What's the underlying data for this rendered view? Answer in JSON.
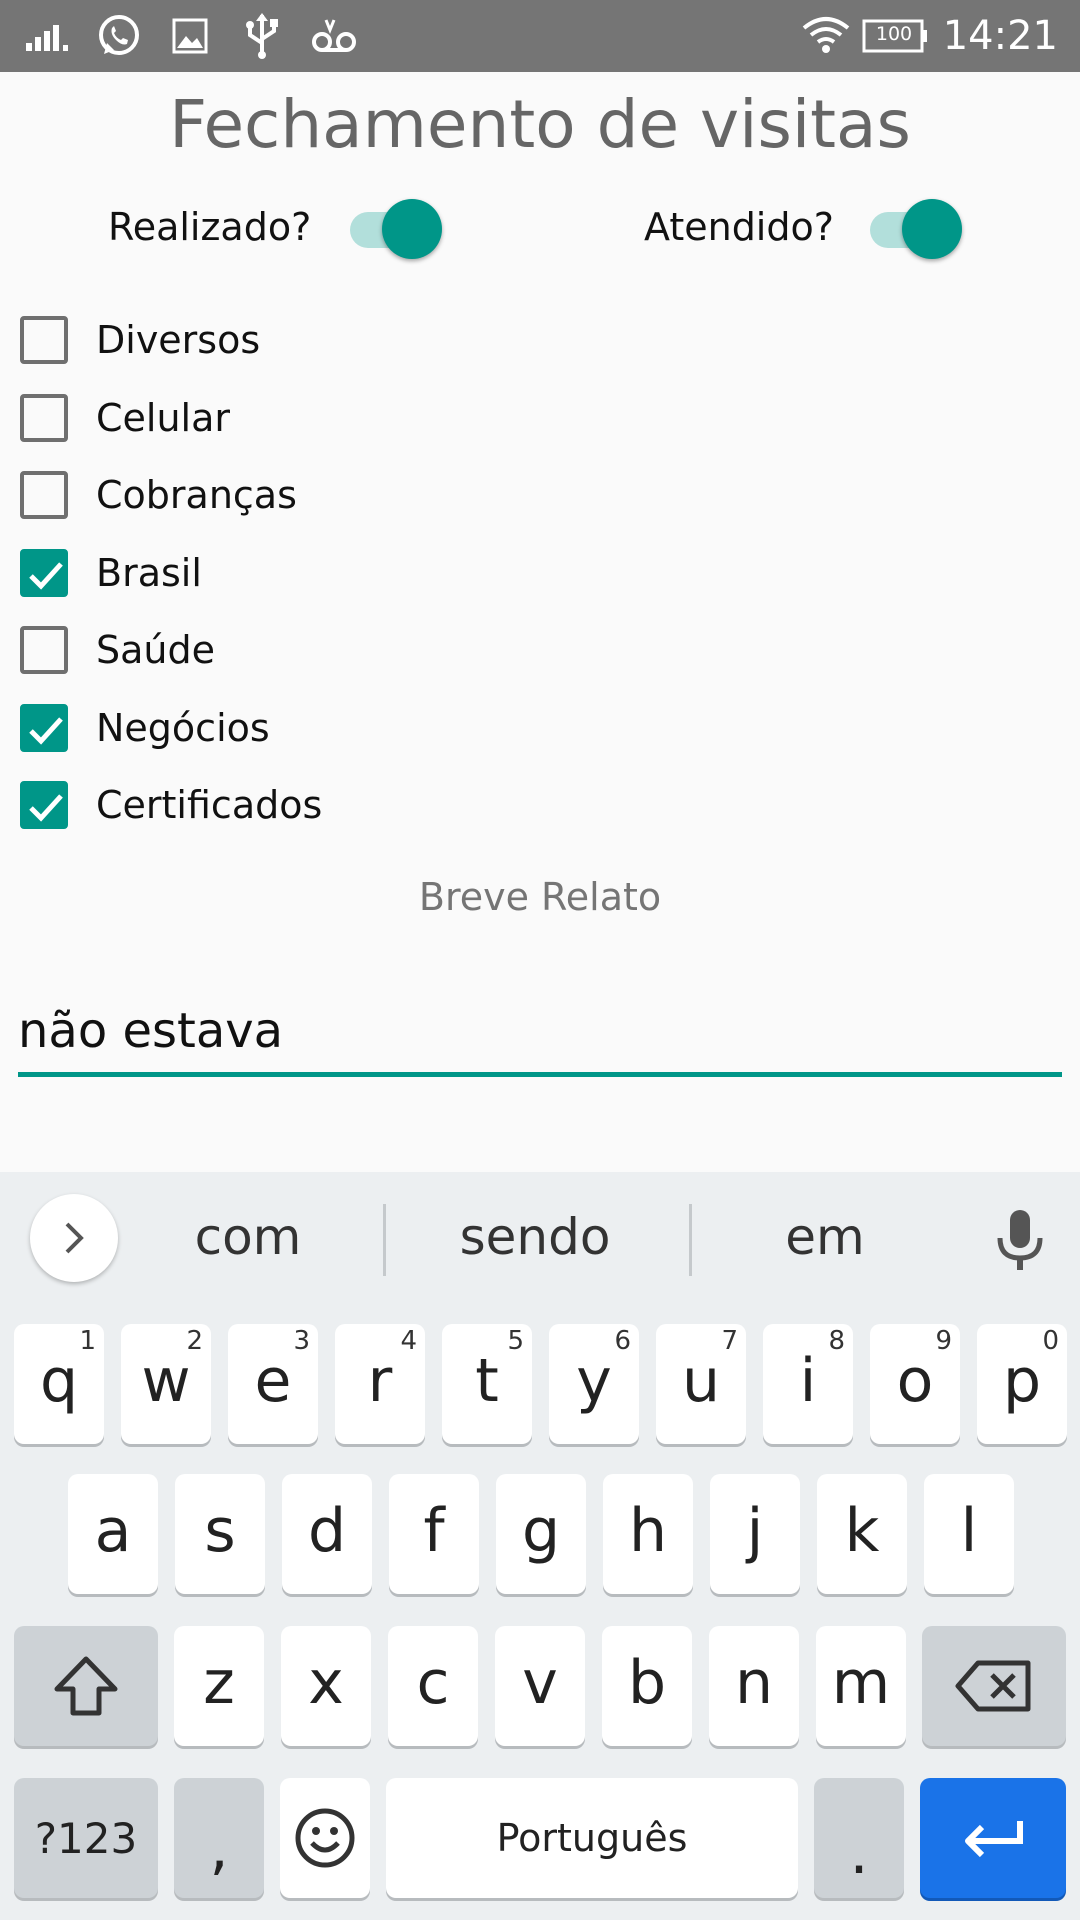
{
  "status_bar": {
    "time": "14:21",
    "battery": "100",
    "icons": [
      "signal-icon",
      "whatsapp-icon",
      "image-icon",
      "usb-icon",
      "voicemail-icon",
      "wifi-icon",
      "battery-icon"
    ]
  },
  "title": "Fechamento de visitas",
  "switches": {
    "realizado": {
      "label": "Realizado?",
      "on": true
    },
    "atendido": {
      "label": "Atendido?",
      "on": true
    }
  },
  "checkboxes": [
    {
      "label": "Diversos",
      "checked": false
    },
    {
      "label": "Celular",
      "checked": false
    },
    {
      "label": "Cobranças",
      "checked": false
    },
    {
      "label": "Brasil",
      "checked": true
    },
    {
      "label": "Saúde",
      "checked": false
    },
    {
      "label": "Negócios",
      "checked": true
    },
    {
      "label": "Certificados",
      "checked": true
    }
  ],
  "relato": {
    "label": "Breve Relato",
    "value": "não estava"
  },
  "keyboard": {
    "suggestions": [
      "com",
      "sendo",
      "em"
    ],
    "row1": [
      {
        "k": "q",
        "h": "1"
      },
      {
        "k": "w",
        "h": "2"
      },
      {
        "k": "e",
        "h": "3"
      },
      {
        "k": "r",
        "h": "4"
      },
      {
        "k": "t",
        "h": "5"
      },
      {
        "k": "y",
        "h": "6"
      },
      {
        "k": "u",
        "h": "7"
      },
      {
        "k": "i",
        "h": "8"
      },
      {
        "k": "o",
        "h": "9"
      },
      {
        "k": "p",
        "h": "0"
      }
    ],
    "row2": [
      "a",
      "s",
      "d",
      "f",
      "g",
      "h",
      "j",
      "k",
      "l"
    ],
    "row3": [
      "z",
      "x",
      "c",
      "v",
      "b",
      "n",
      "m"
    ],
    "symbols_label": "?123",
    "comma": ",",
    "space_label": "Português",
    "period": ".",
    "accent_color": "#1a73e8",
    "teal": "#009688"
  }
}
